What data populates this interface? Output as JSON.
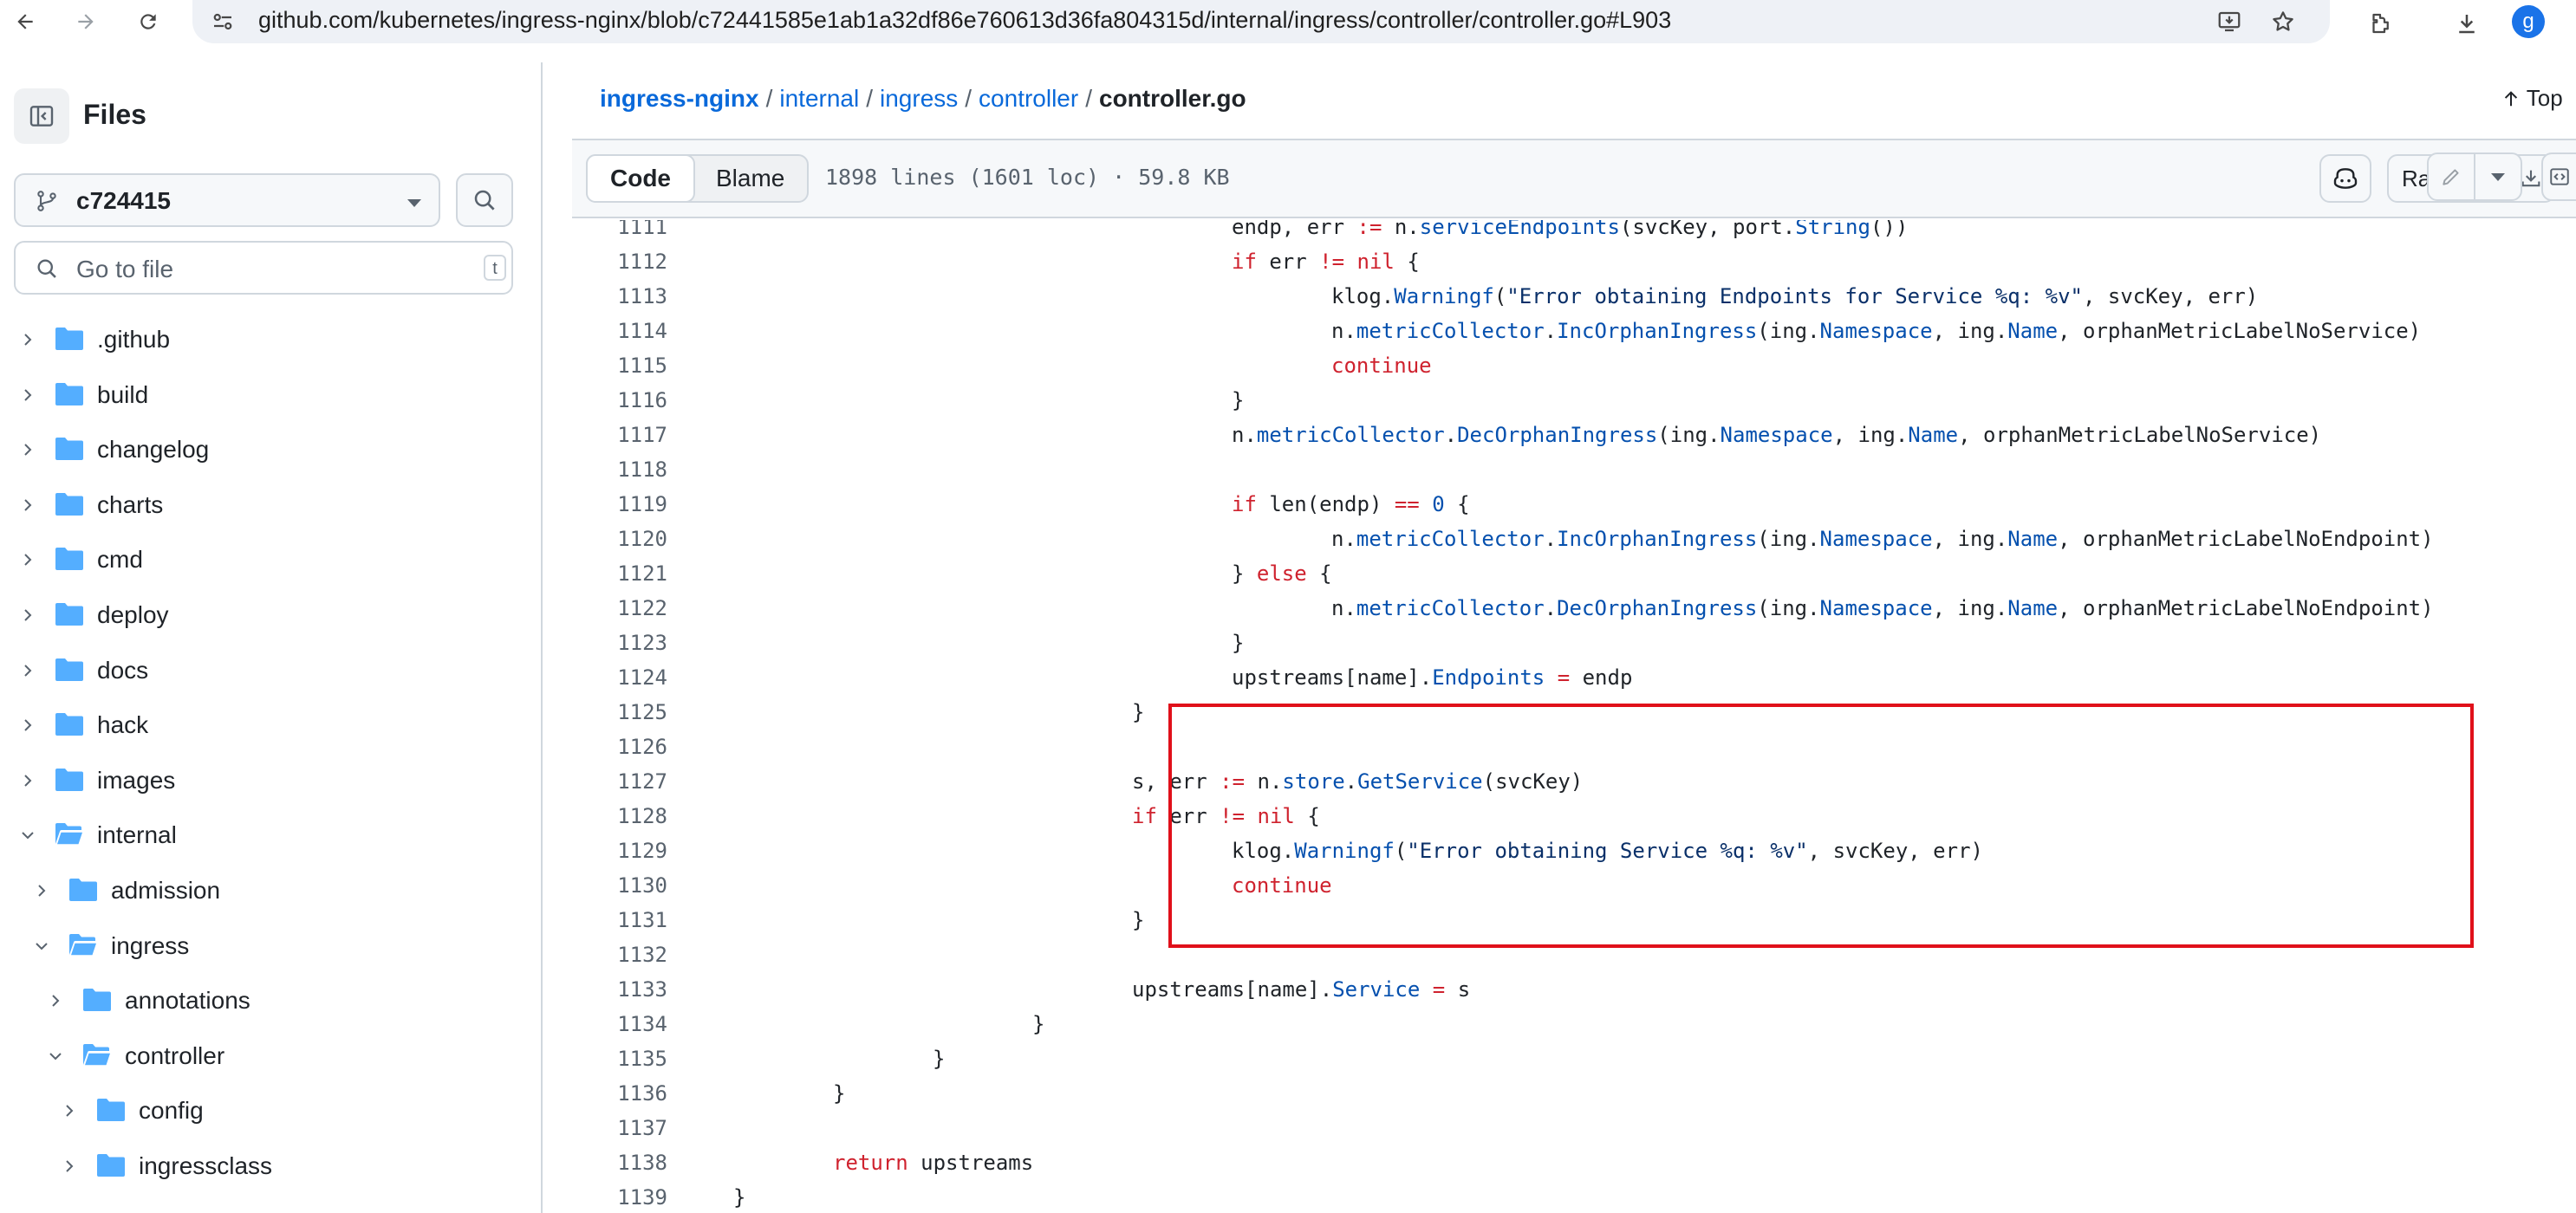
{
  "browser": {
    "url": "github.com/kubernetes/ingress-nginx/blob/c72441585e1ab1a32df86e760613d36fa804315d/internal/ingress/controller/controller.go#L903",
    "profile_initial": "g"
  },
  "sidebar": {
    "title": "Files",
    "branch": "c724415",
    "goto_placeholder": "Go to file",
    "goto_shortcut": "t",
    "tree": [
      {
        "label": ".github",
        "level": 0,
        "expanded": false
      },
      {
        "label": "build",
        "level": 0,
        "expanded": false
      },
      {
        "label": "changelog",
        "level": 0,
        "expanded": false
      },
      {
        "label": "charts",
        "level": 0,
        "expanded": false
      },
      {
        "label": "cmd",
        "level": 0,
        "expanded": false
      },
      {
        "label": "deploy",
        "level": 0,
        "expanded": false
      },
      {
        "label": "docs",
        "level": 0,
        "expanded": false
      },
      {
        "label": "hack",
        "level": 0,
        "expanded": false
      },
      {
        "label": "images",
        "level": 0,
        "expanded": false
      },
      {
        "label": "internal",
        "level": 0,
        "expanded": true
      },
      {
        "label": "admission",
        "level": 1,
        "expanded": false
      },
      {
        "label": "ingress",
        "level": 1,
        "expanded": true
      },
      {
        "label": "annotations",
        "level": 2,
        "expanded": false
      },
      {
        "label": "controller",
        "level": 2,
        "expanded": true
      },
      {
        "label": "config",
        "level": 3,
        "expanded": false
      },
      {
        "label": "ingressclass",
        "level": 3,
        "expanded": false
      }
    ]
  },
  "breadcrumb": {
    "repo": "ingress-nginx",
    "parts": [
      "internal",
      "ingress",
      "controller"
    ],
    "current": "controller.go",
    "top_label": "Top"
  },
  "file_header": {
    "code_tab": "Code",
    "blame_tab": "Blame",
    "info": "1898 lines (1601 loc) · 59.8 KB",
    "raw_label": "Raw"
  },
  "code": {
    "lines": [
      {
        "n": "1111",
        "indent": 5,
        "html": "endp, err <span class='op'>:=</span> n.<span class='fn'>serviceEndpoints</span>(svcKey, port.<span class='fn'>String</span>())"
      },
      {
        "n": "1112",
        "indent": 5,
        "html": "<span class='kw'>if</span> err <span class='op'>!=</span> <span class='kw'>nil</span> {"
      },
      {
        "n": "1113",
        "indent": 6,
        "html": "klog.<span class='fn'>Warningf</span>(<span class='str'>\"Error obtaining Endpoints for Service %q: %v\"</span>, svcKey, err)"
      },
      {
        "n": "1114",
        "indent": 6,
        "html": "n.<span class='fn'>metricCollector</span>.<span class='fn'>IncOrphanIngress</span>(ing.<span class='fn'>Namespace</span>, ing.<span class='fn'>Name</span>, orphanMetricLabelNoService)"
      },
      {
        "n": "1115",
        "indent": 6,
        "html": "<span class='kw'>continue</span>"
      },
      {
        "n": "1116",
        "indent": 5,
        "html": "}"
      },
      {
        "n": "1117",
        "indent": 5,
        "html": "n.<span class='fn'>metricCollector</span>.<span class='fn'>DecOrphanIngress</span>(ing.<span class='fn'>Namespace</span>, ing.<span class='fn'>Name</span>, orphanMetricLabelNoService)"
      },
      {
        "n": "1118",
        "indent": 0,
        "html": ""
      },
      {
        "n": "1119",
        "indent": 5,
        "html": "<span class='kw'>if</span> len(endp) <span class='op'>==</span> <span class='num'>0</span> {"
      },
      {
        "n": "1120",
        "indent": 6,
        "html": "n.<span class='fn'>metricCollector</span>.<span class='fn'>IncOrphanIngress</span>(ing.<span class='fn'>Namespace</span>, ing.<span class='fn'>Name</span>, orphanMetricLabelNoEndpoint)"
      },
      {
        "n": "1121",
        "indent": 5,
        "html": "} <span class='kw'>else</span> {"
      },
      {
        "n": "1122",
        "indent": 6,
        "html": "n.<span class='fn'>metricCollector</span>.<span class='fn'>DecOrphanIngress</span>(ing.<span class='fn'>Namespace</span>, ing.<span class='fn'>Name</span>, orphanMetricLabelNoEndpoint)"
      },
      {
        "n": "1123",
        "indent": 5,
        "html": "}"
      },
      {
        "n": "1124",
        "indent": 5,
        "html": "upstreams[name].<span class='fn'>Endpoints</span> <span class='op'>=</span> endp"
      },
      {
        "n": "1125",
        "indent": 4,
        "html": "}"
      },
      {
        "n": "1126",
        "indent": 0,
        "html": ""
      },
      {
        "n": "1127",
        "indent": 4,
        "html": "s, err <span class='op'>:=</span> n.<span class='fn'>store</span>.<span class='fn'>GetService</span>(svcKey)"
      },
      {
        "n": "1128",
        "indent": 4,
        "html": "<span class='kw'>if</span> err <span class='op'>!=</span> <span class='kw'>nil</span> {"
      },
      {
        "n": "1129",
        "indent": 5,
        "html": "klog.<span class='fn'>Warningf</span>(<span class='str'>\"Error obtaining Service %q: %v\"</span>, svcKey, err)"
      },
      {
        "n": "1130",
        "indent": 5,
        "html": "<span class='kw'>continue</span>"
      },
      {
        "n": "1131",
        "indent": 4,
        "html": "}"
      },
      {
        "n": "1132",
        "indent": 0,
        "html": ""
      },
      {
        "n": "1133",
        "indent": 4,
        "html": "upstreams[name].<span class='fn'>Service</span> <span class='op'>=</span> s"
      },
      {
        "n": "1134",
        "indent": 3,
        "html": "}"
      },
      {
        "n": "1135",
        "indent": 2,
        "html": "}"
      },
      {
        "n": "1136",
        "indent": 1,
        "html": "}"
      },
      {
        "n": "1137",
        "indent": 0,
        "html": ""
      },
      {
        "n": "1138",
        "indent": 1,
        "html": "<span class='kw'>return</span> upstreams"
      },
      {
        "n": "1139",
        "indent": 0,
        "html": "}"
      }
    ]
  },
  "colors": {
    "link": "#0969da",
    "keyword": "#cf222e",
    "entity": "#0550ae",
    "string": "#0a3069",
    "highlight": "#e0101a"
  }
}
